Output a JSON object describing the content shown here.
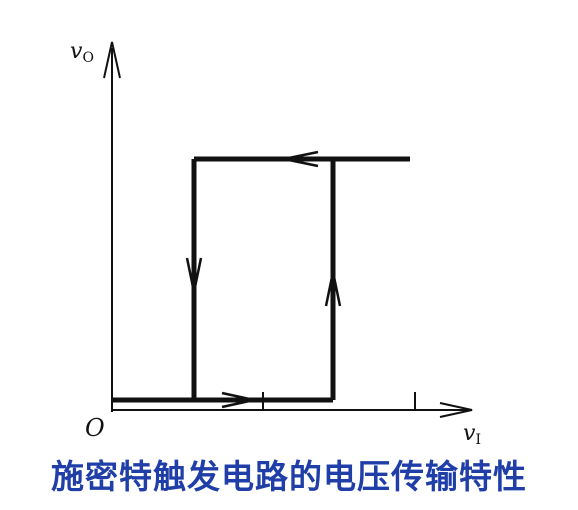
{
  "figure": {
    "x_axis_label": "v",
    "x_axis_subscript": "I",
    "y_axis_label": "v",
    "y_axis_subscript": "O",
    "origin_label": "O",
    "caption": "施密特触发电路的电压传输特性"
  },
  "colors": {
    "line": "#111111",
    "caption": "#1f3ea8"
  }
}
